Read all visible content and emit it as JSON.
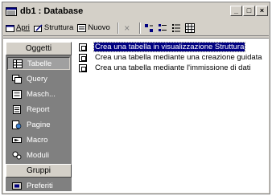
{
  "window": {
    "title": "db1 : Database",
    "controls": [
      "_",
      "□",
      "×"
    ]
  },
  "toolbar": {
    "open_label": "Apri",
    "design_label": "Struttura",
    "new_label": "Nuovo",
    "delete_icon": "×",
    "icons": [
      "large-icons-icon",
      "small-icons-icon",
      "list-view-icon",
      "details-view-icon"
    ]
  },
  "sidebar": {
    "objects_label": "Oggetti",
    "groups_label": "Gruppi",
    "items": [
      {
        "label": "Tabelle",
        "icon": "table-icon",
        "selected": true
      },
      {
        "label": "Query",
        "icon": "query-icon",
        "selected": false
      },
      {
        "label": "Masch...",
        "icon": "form-icon",
        "selected": false
      },
      {
        "label": "Report",
        "icon": "report-icon",
        "selected": false
      },
      {
        "label": "Pagine",
        "icon": "page-icon",
        "selected": false
      },
      {
        "label": "Macro",
        "icon": "macro-icon",
        "selected": false
      },
      {
        "label": "Moduli",
        "icon": "module-icon",
        "selected": false
      }
    ],
    "group_items": [
      {
        "label": "Preferiti",
        "icon": "favorites-icon"
      }
    ]
  },
  "list": {
    "items": [
      {
        "label": "Crea una tabella in visualizzazione Struttura",
        "selected": true
      },
      {
        "label": "Crea una tabella mediante una creazione guidata",
        "selected": false
      },
      {
        "label": "Crea una tabella mediante l'immissione di dati",
        "selected": false
      }
    ]
  }
}
